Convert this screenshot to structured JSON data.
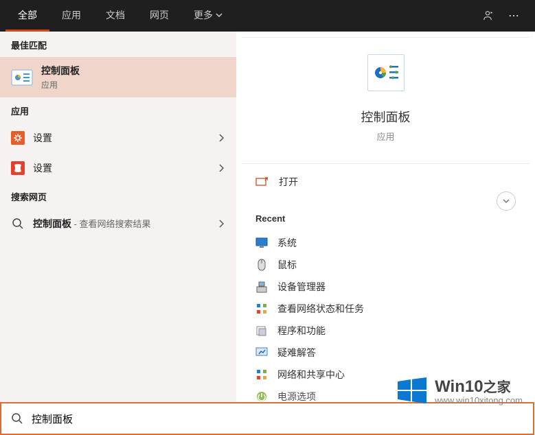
{
  "tabs": {
    "all": "全部",
    "apps": "应用",
    "docs": "文档",
    "web": "网页",
    "more": "更多"
  },
  "left": {
    "best_match_header": "最佳匹配",
    "best_match": {
      "title": "控制面板",
      "subtitle": "应用"
    },
    "apps_header": "应用",
    "app_settings_1": "设置",
    "app_settings_2": "设置",
    "web_header": "搜索网页",
    "web_result_title": "控制面板",
    "web_result_suffix": " - 查看网络搜索结果"
  },
  "preview": {
    "title": "控制面板",
    "subtitle": "应用",
    "open_label": "打开"
  },
  "recent": {
    "header": "Recent",
    "items": [
      "系统",
      "鼠标",
      "设备管理器",
      "查看网络状态和任务",
      "程序和功能",
      "疑难解答",
      "网络和共享中心",
      "电源选项"
    ]
  },
  "search": {
    "value": "控制面板"
  },
  "watermark": {
    "main": "Win10",
    "zhijia": "之家",
    "url": "www.win10xitong.com"
  }
}
